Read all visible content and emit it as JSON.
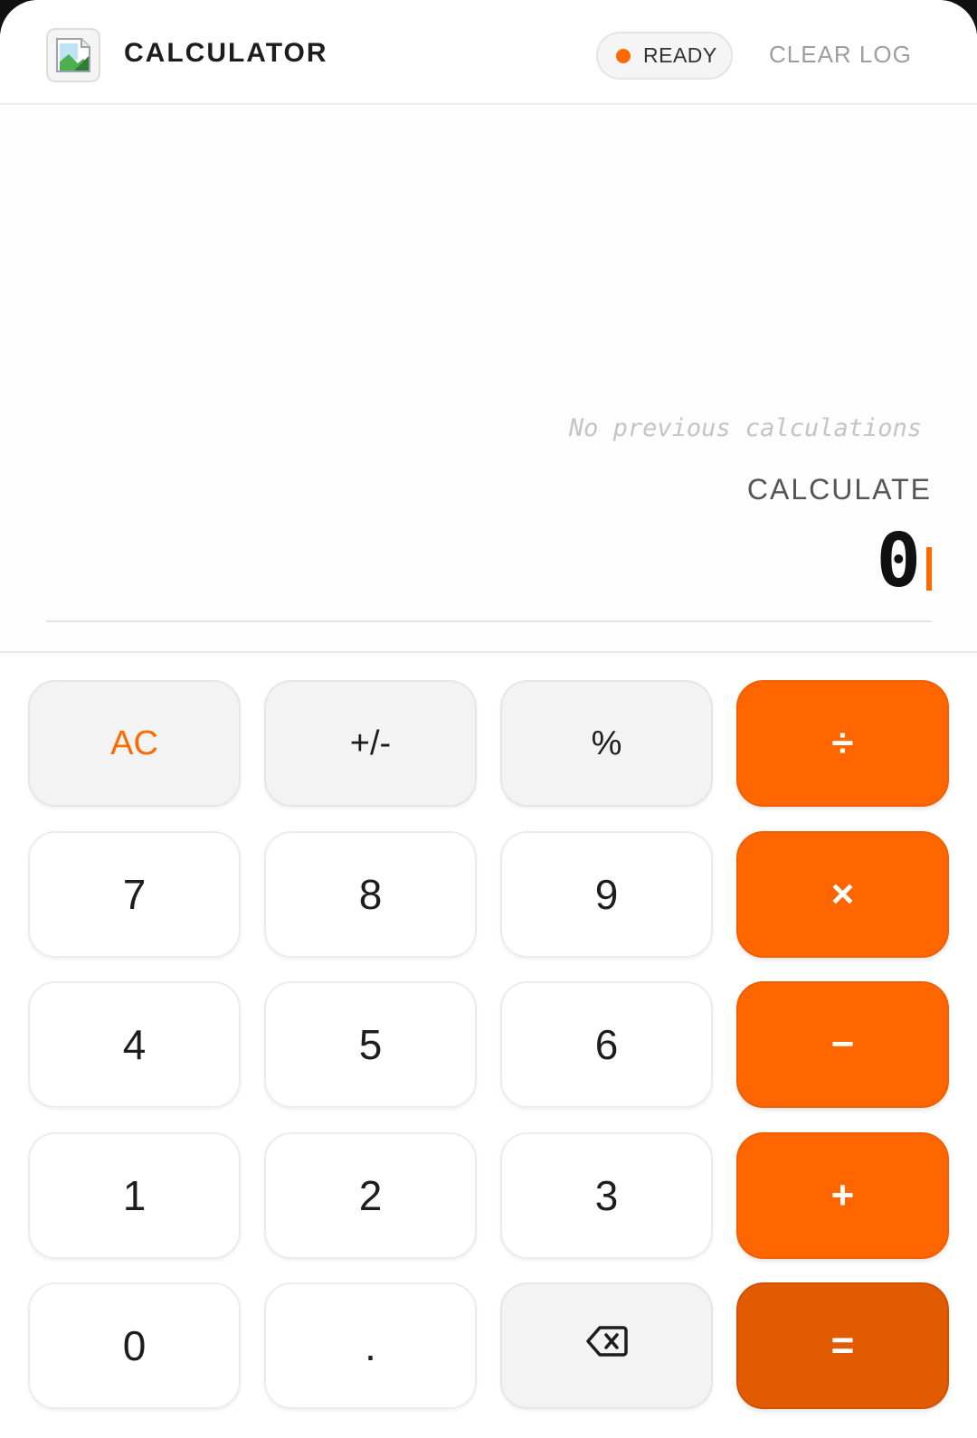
{
  "header": {
    "title": "CALCULATOR",
    "status": "READY",
    "clear_log": "CLEAR LOG",
    "icon": "broken-image-icon"
  },
  "display": {
    "history_empty": "No previous calculations",
    "label": "CALCULATE",
    "value": "0"
  },
  "keys": {
    "ac": "AC",
    "sign": "+/-",
    "percent": "%",
    "divide": "÷",
    "seven": "7",
    "eight": "8",
    "nine": "9",
    "multiply": "×",
    "four": "4",
    "five": "5",
    "six": "6",
    "minus": "−",
    "one": "1",
    "two": "2",
    "three": "3",
    "plus": "+",
    "zero": "0",
    "decimal": ".",
    "backspace_icon": "backspace-icon",
    "equals": "="
  },
  "colors": {
    "accent": "#ff6600",
    "accent_dark": "#e35b00",
    "status_dot": "#ff6a00"
  }
}
